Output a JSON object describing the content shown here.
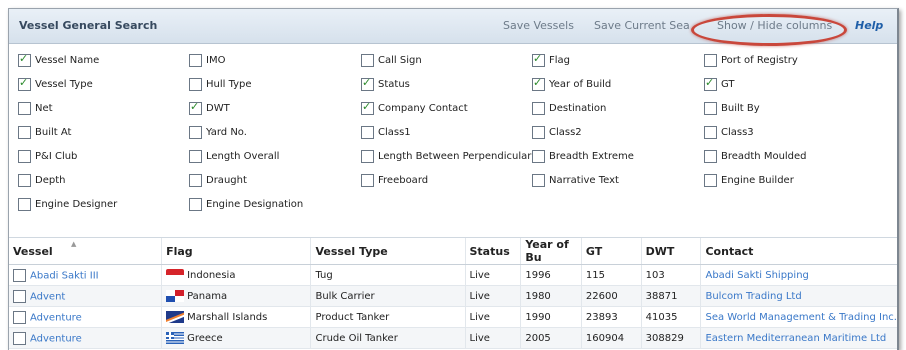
{
  "header": {
    "title": "Vessel General Search",
    "save_vessels": "Save Vessels",
    "save_current_search": "Save Current Search",
    "show_hide_columns": "Show / Hide columns",
    "help": "Help"
  },
  "columns": [
    {
      "label": "Vessel Name",
      "checked": true
    },
    {
      "label": "IMO",
      "checked": false
    },
    {
      "label": "Call Sign",
      "checked": false
    },
    {
      "label": "Flag",
      "checked": true
    },
    {
      "label": "Port of Registry",
      "checked": false
    },
    {
      "label": "Vessel Type",
      "checked": true
    },
    {
      "label": "Hull Type",
      "checked": false
    },
    {
      "label": "Status",
      "checked": true
    },
    {
      "label": "Year of Build",
      "checked": true
    },
    {
      "label": "GT",
      "checked": true
    },
    {
      "label": "Net",
      "checked": false
    },
    {
      "label": "DWT",
      "checked": true
    },
    {
      "label": "Company Contact",
      "checked": true
    },
    {
      "label": "Destination",
      "checked": false
    },
    {
      "label": "Built By",
      "checked": false
    },
    {
      "label": "Built At",
      "checked": false
    },
    {
      "label": "Yard No.",
      "checked": false
    },
    {
      "label": "Class1",
      "checked": false
    },
    {
      "label": "Class2",
      "checked": false
    },
    {
      "label": "Class3",
      "checked": false
    },
    {
      "label": "P&I Club",
      "checked": false
    },
    {
      "label": "Length Overall",
      "checked": false
    },
    {
      "label": "Length Between Perpendicular",
      "checked": false
    },
    {
      "label": "Breadth Extreme",
      "checked": false
    },
    {
      "label": "Breadth Moulded",
      "checked": false
    },
    {
      "label": "Depth",
      "checked": false
    },
    {
      "label": "Draught",
      "checked": false
    },
    {
      "label": "Freeboard",
      "checked": false
    },
    {
      "label": "Narrative Text",
      "checked": false
    },
    {
      "label": "Engine Builder",
      "checked": false
    },
    {
      "label": "Engine Designer",
      "checked": false
    },
    {
      "label": "Engine Designation",
      "checked": false
    }
  ],
  "table": {
    "headers": [
      "Vessel",
      "Flag",
      "Vessel Type",
      "Status",
      "Year of Bu",
      "GT",
      "DWT",
      "Contact"
    ],
    "rows": [
      {
        "vessel": "Abadi Sakti III",
        "flag": "Indonesia",
        "flag_icon": "indonesia-flag-icon",
        "type": "Tug",
        "status": "Live",
        "year": "1996",
        "gt": "115",
        "dwt": "103",
        "contact": "Abadi Sakti Shipping"
      },
      {
        "vessel": "Advent",
        "flag": "Panama",
        "flag_icon": "panama-flag-icon",
        "type": "Bulk Carrier",
        "status": "Live",
        "year": "1980",
        "gt": "22600",
        "dwt": "38871",
        "contact": "Bulcom Trading Ltd"
      },
      {
        "vessel": "Adventure",
        "flag": "Marshall Islands",
        "flag_icon": "marshall-islands-flag-icon",
        "type": "Product Tanker",
        "status": "Live",
        "year": "1990",
        "gt": "23893",
        "dwt": "41035",
        "contact": "Sea World Management & Trading Inc."
      },
      {
        "vessel": "Adventure",
        "flag": "Greece",
        "flag_icon": "greece-flag-icon",
        "type": "Crude Oil Tanker",
        "status": "Live",
        "year": "2005",
        "gt": "160904",
        "dwt": "308829",
        "contact": "Eastern Mediterranean Maritime Ltd"
      }
    ]
  },
  "colors": {
    "header_bg": "#dbe5ef",
    "link": "#3a78c8",
    "highlight_oval": "#c9473b",
    "help": "#1f5fa8"
  }
}
